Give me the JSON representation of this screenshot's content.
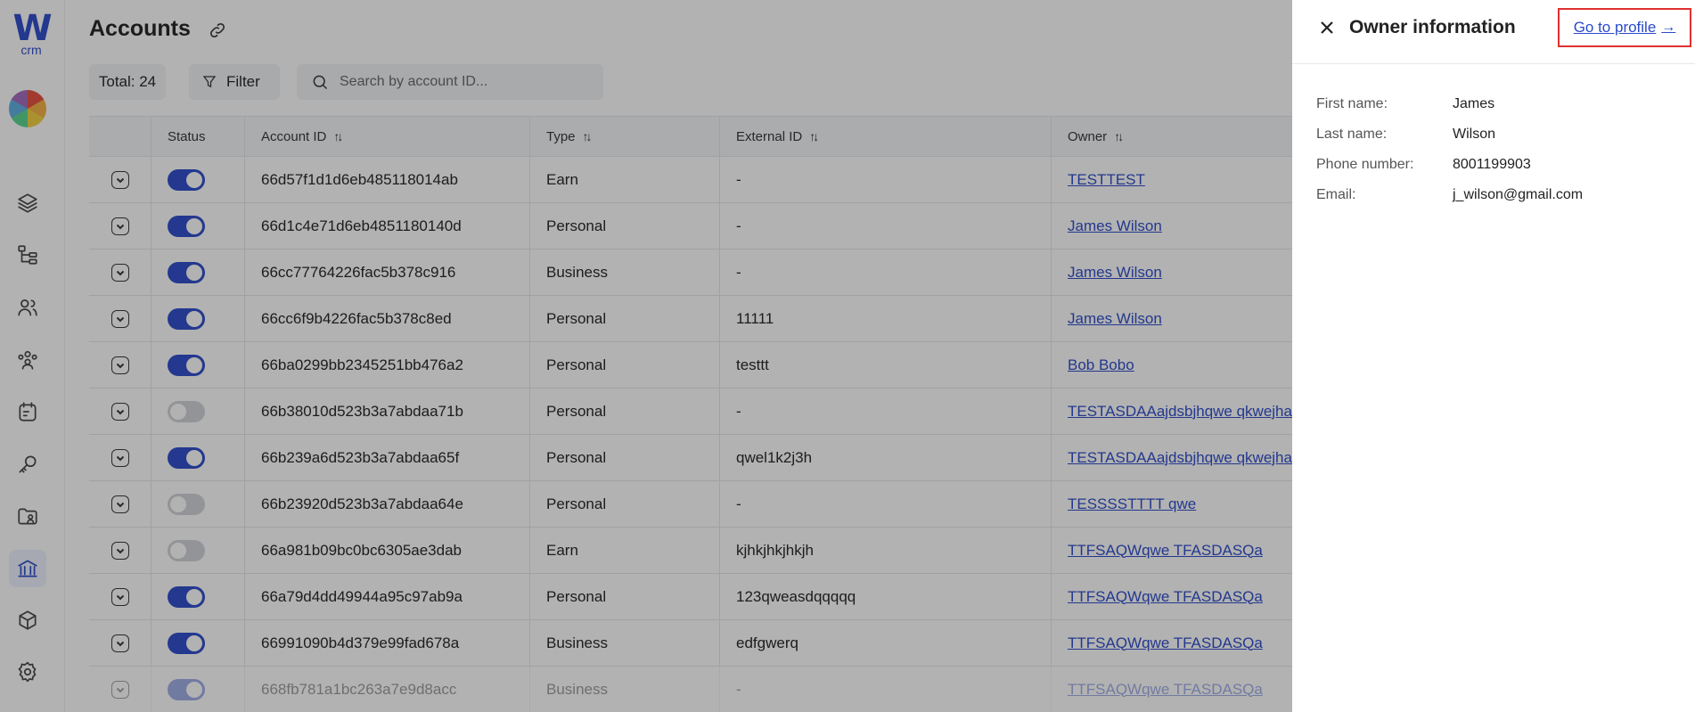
{
  "app": {
    "logo_mark": "W",
    "logo_sub": "crm"
  },
  "sidebar": {
    "items": [
      {
        "icon": "layers-icon"
      },
      {
        "icon": "hierarchy-icon"
      },
      {
        "icon": "users-icon"
      },
      {
        "icon": "group-icon"
      },
      {
        "icon": "calendar-edit-icon"
      },
      {
        "icon": "key-icon"
      },
      {
        "icon": "folder-user-icon"
      },
      {
        "icon": "bank-icon",
        "active": true
      },
      {
        "icon": "box-icon"
      },
      {
        "icon": "gear-icon"
      }
    ]
  },
  "header": {
    "title": "Accounts"
  },
  "toolbar": {
    "total_label": "Total: 24",
    "filter_label": "Filter",
    "search_placeholder": "Search by account ID..."
  },
  "table": {
    "columns": {
      "status": "Status",
      "account_id": "Account ID",
      "type": "Type",
      "external_id": "External ID",
      "owner": "Owner"
    },
    "rows": [
      {
        "status_on": true,
        "account_id": "66d57f1d1d6eb485118014ab",
        "type": "Earn",
        "external_id": "-",
        "owner": "TESTTEST"
      },
      {
        "status_on": true,
        "account_id": "66d1c4e71d6eb4851180140d",
        "type": "Personal",
        "external_id": "-",
        "owner": "James Wilson"
      },
      {
        "status_on": true,
        "account_id": "66cc77764226fac5b378c916",
        "type": "Business",
        "external_id": "-",
        "owner": "James Wilson"
      },
      {
        "status_on": true,
        "account_id": "66cc6f9b4226fac5b378c8ed",
        "type": "Personal",
        "external_id": "11111",
        "owner": "James Wilson"
      },
      {
        "status_on": true,
        "account_id": "66ba0299bb2345251bb476a2",
        "type": "Personal",
        "external_id": "testtt",
        "owner": "Bob Bobo"
      },
      {
        "status_on": false,
        "account_id": "66b38010d523b3a7abdaa71b",
        "type": "Personal",
        "external_id": "-",
        "owner": "TESTASDAAajdsbjhqwe qkwejhakjsd"
      },
      {
        "status_on": true,
        "account_id": "66b239a6d523b3a7abdaa65f",
        "type": "Personal",
        "external_id": "qwel1k2j3h",
        "owner": "TESTASDAAajdsbjhqwe qkwejhakjsd"
      },
      {
        "status_on": false,
        "account_id": "66b23920d523b3a7abdaa64e",
        "type": "Personal",
        "external_id": "-",
        "owner": "TESSSSTTTT qwe"
      },
      {
        "status_on": false,
        "account_id": "66a981b09bc0bc6305ae3dab",
        "type": "Earn",
        "external_id": "kjhkjhkjhkjh",
        "owner": "TTFSAQWqwe TFASDASQa"
      },
      {
        "status_on": true,
        "account_id": "66a79d4dd49944a95c97ab9a",
        "type": "Personal",
        "external_id": "123qweasdqqqqq",
        "owner": "TTFSAQWqwe TFASDASQa"
      },
      {
        "status_on": true,
        "account_id": "66991090b4d379e99fad678a",
        "type": "Business",
        "external_id": "edfgwerq",
        "owner": "TTFSAQWqwe TFASDASQa"
      },
      {
        "status_on": true,
        "account_id": "668fb781a1bc263a7e9d8acc",
        "type": "Business",
        "external_id": "-",
        "owner": "TTFSAQWqwe TFASDASQa"
      }
    ]
  },
  "drawer": {
    "title": "Owner information",
    "profile_link": "Go to profile",
    "profile_arrow": "→",
    "fields": [
      {
        "label": "First name:",
        "value": "James"
      },
      {
        "label": "Last name:",
        "value": "Wilson"
      },
      {
        "label": "Phone number:",
        "value": "8001199903"
      },
      {
        "label": "Email:",
        "value": "j_wilson@gmail.com"
      }
    ]
  },
  "colors": {
    "accent": "#2B4AC9",
    "highlight_border": "#E03030"
  }
}
